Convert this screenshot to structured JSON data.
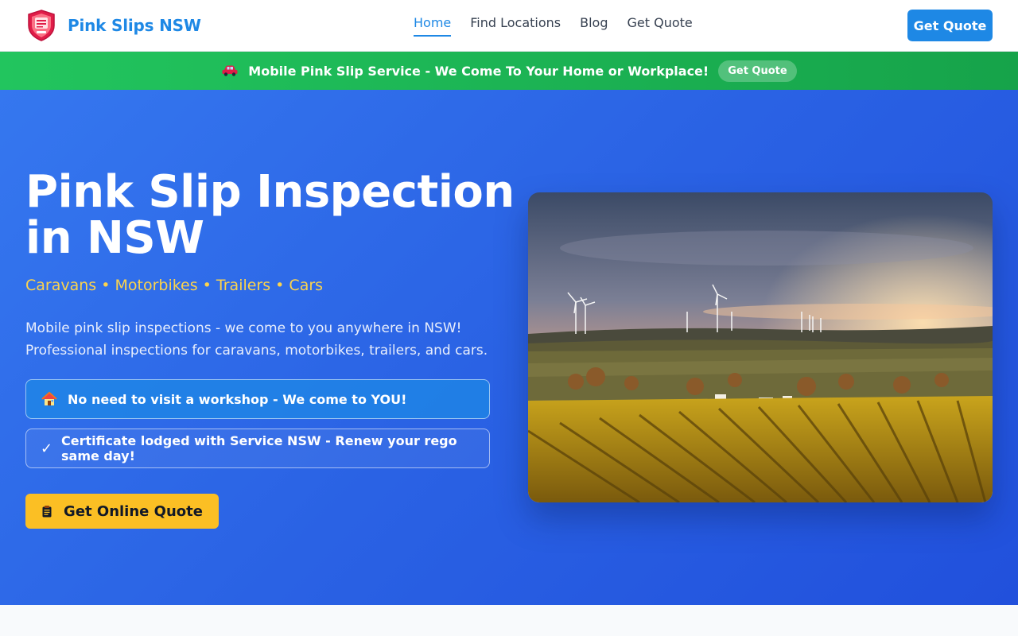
{
  "header": {
    "brand": "Pink Slips NSW",
    "logo_icon": "pink-slips-shield-logo",
    "nav": [
      {
        "label": "Home",
        "active": true
      },
      {
        "label": "Find Locations",
        "active": false
      },
      {
        "label": "Blog",
        "active": false
      },
      {
        "label": "Get Quote",
        "active": false
      }
    ],
    "cta_label": "Get Quote"
  },
  "promo": {
    "icon": "car-icon",
    "text": "Mobile Pink Slip Service - We Come To Your Home or Workplace!",
    "button_label": "Get Quote"
  },
  "hero": {
    "title": "Pink Slip Inspection in NSW",
    "subtitle": "Caravans • Motorbikes • Trailers • Cars",
    "description": "Mobile pink slip inspections - we come to you anywhere in NSW! Professional inspections for caravans, motorbikes, trailers, and cars.",
    "features": [
      {
        "icon": "house-icon",
        "text": "No need to visit a workshop - We come to YOU!"
      },
      {
        "icon": "check-icon",
        "text": "Certificate lodged with Service NSW - Renew your rego same day!"
      }
    ],
    "cta_label": "Get Online Quote",
    "cta_icon": "clipboard-icon",
    "image": "vineyard-wind-turbines-sunset"
  },
  "colors": {
    "brand_blue": "#1e88e5",
    "promo_green": "#22c55e",
    "hero_blue": "#2a62e4",
    "accent_yellow": "#fbbf24",
    "subtitle_yellow": "#fcd34d"
  }
}
